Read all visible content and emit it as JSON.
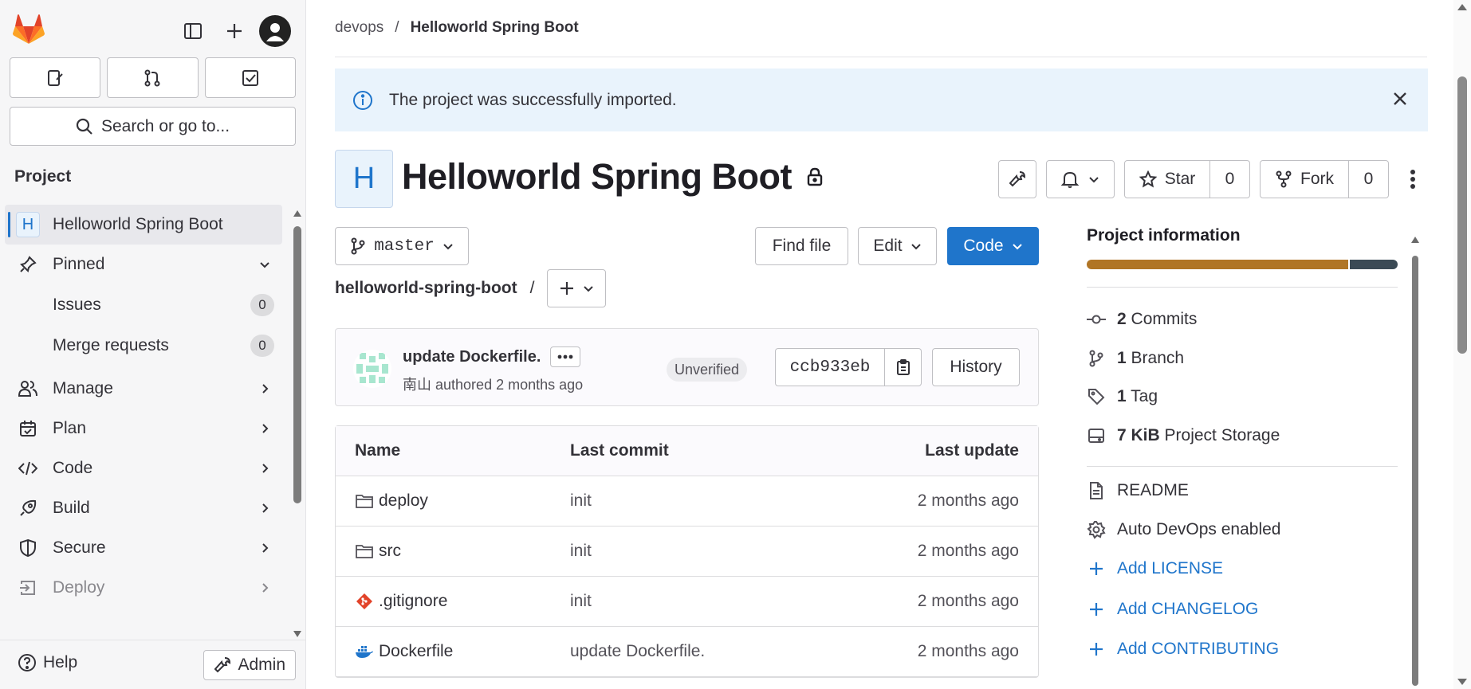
{
  "sidebar": {
    "search_label": "Search or go to...",
    "section_title": "Project",
    "project_item": {
      "initial": "H",
      "label": "Helloworld Spring Boot"
    },
    "pinned_label": "Pinned",
    "pinned_items": [
      {
        "label": "Issues",
        "count": "0"
      },
      {
        "label": "Merge requests",
        "count": "0"
      }
    ],
    "menu": [
      {
        "label": "Manage",
        "icon": "manage-icon"
      },
      {
        "label": "Plan",
        "icon": "plan-icon"
      },
      {
        "label": "Code",
        "icon": "code-icon"
      },
      {
        "label": "Build",
        "icon": "build-icon"
      },
      {
        "label": "Secure",
        "icon": "secure-icon"
      },
      {
        "label": "Deploy",
        "icon": "deploy-icon"
      }
    ],
    "help_label": "Help",
    "admin_label": "Admin"
  },
  "breadcrumb": {
    "group": "devops",
    "separator": "/",
    "current": "Helloworld Spring Boot"
  },
  "alert": {
    "message": "The project was successfully imported."
  },
  "project": {
    "initial": "H",
    "title": "Helloworld Spring Boot",
    "star_label": "Star",
    "star_count": "0",
    "fork_label": "Fork",
    "fork_count": "0"
  },
  "toolbar": {
    "branch": "master",
    "find_file": "Find file",
    "edit": "Edit",
    "code": "Code",
    "repo_path": "helloworld-spring-boot",
    "path_separator": "/"
  },
  "last_commit": {
    "title": "update Dockerfile.",
    "author": "南山",
    "meta": "authored 2 months ago",
    "status": "Unverified",
    "sha": "ccb933eb",
    "history_label": "History"
  },
  "file_table": {
    "headers": {
      "name": "Name",
      "last_commit": "Last commit",
      "last_update": "Last update"
    },
    "rows": [
      {
        "name": "deploy",
        "type": "folder-icon",
        "commit": "init",
        "updated": "2 months ago"
      },
      {
        "name": "src",
        "type": "folder-icon",
        "commit": "init",
        "updated": "2 months ago"
      },
      {
        "name": ".gitignore",
        "type": "git-icon",
        "commit": "init",
        "updated": "2 months ago"
      },
      {
        "name": "Dockerfile",
        "type": "docker-icon",
        "commit": "update Dockerfile.",
        "updated": "2 months ago"
      }
    ]
  },
  "project_info": {
    "title": "Project information",
    "language_share": {
      "primary": 0.84,
      "secondary": 0.16
    },
    "stats": [
      {
        "value": "2",
        "label": "Commits",
        "icon": "commit-icon"
      },
      {
        "value": "1",
        "label": "Branch",
        "icon": "branch-icon"
      },
      {
        "value": "1",
        "label": "Tag",
        "icon": "tag-icon"
      },
      {
        "value": "7 KiB",
        "label": "Project Storage",
        "icon": "storage-icon"
      }
    ],
    "links": [
      {
        "label": "README",
        "icon": "document-icon",
        "kind": "plain"
      },
      {
        "label": "Auto DevOps enabled",
        "icon": "settings-icon",
        "kind": "plain"
      },
      {
        "label": "Add LICENSE",
        "icon": "plus-icon",
        "kind": "link"
      },
      {
        "label": "Add CHANGELOG",
        "icon": "plus-icon",
        "kind": "link"
      },
      {
        "label": "Add CONTRIBUTING",
        "icon": "plus-icon",
        "kind": "link"
      }
    ]
  },
  "colors": {
    "accent": "#1f75cb",
    "lang_primary": "#b07525",
    "lang_secondary": "#3b4a55",
    "alert_bg": "#e9f3fc"
  }
}
